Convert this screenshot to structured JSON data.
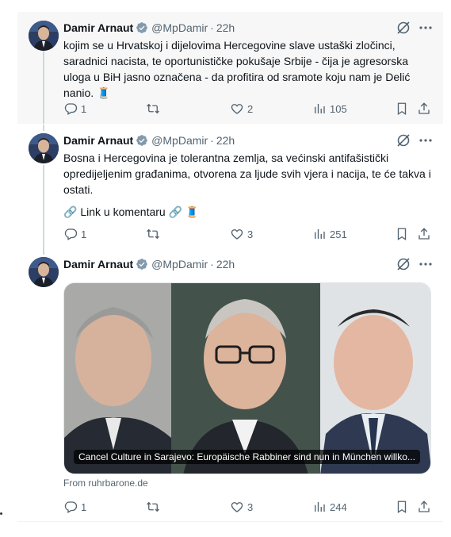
{
  "tweets": [
    {
      "author": {
        "name": "Damir Arnaut",
        "handle": "@MpDamir",
        "time": "22h"
      },
      "text": "kojim se u Hrvatskoj i dijelovima Hercegovine slave ustaški zločinci, saradnici nacista, te oportunističke pokušaje Srbije - čija je agresorska uloga u BiH jasno označena - da profitira od sramote koju nam je Delić nanio. 🧵",
      "stats": {
        "replies": "1",
        "reposts": "",
        "likes": "2",
        "views": "105"
      }
    },
    {
      "author": {
        "name": "Damir Arnaut",
        "handle": "@MpDamir",
        "time": "22h"
      },
      "text": "Bosna i Hercegovina je tolerantna zemlja, sa većinski antifašistički opredijeljenim građanima, otvorena za ljude svih vjera i nacija, te će takva i ostati.",
      "text2": "🔗 Link u komentaru 🔗 🧵",
      "stats": {
        "replies": "1",
        "reposts": "",
        "likes": "3",
        "views": "251"
      }
    },
    {
      "author": {
        "name": "Damir Arnaut",
        "handle": "@MpDamir",
        "time": "22h"
      },
      "card": {
        "title": "Cancel Culture in Sarajevo: Europäische Rabbiner sind nun in München willko...",
        "source": "From ruhrbarone.de"
      },
      "stats": {
        "replies": "1",
        "reposts": "",
        "likes": "3",
        "views": "244"
      }
    }
  ],
  "icons": {
    "verified": "verified-badge-icon",
    "grok": "grok-icon",
    "more": "more-icon",
    "reply": "reply-icon",
    "repost": "repost-icon",
    "like": "like-icon",
    "views": "views-icon",
    "bookmark": "bookmark-icon",
    "share": "share-icon"
  },
  "colors": {
    "verified": "#829aab",
    "muted": "#536471",
    "text": "#0f1419",
    "thread_line": "#cfd9de",
    "highlight_bg": "#f7f7f7"
  }
}
